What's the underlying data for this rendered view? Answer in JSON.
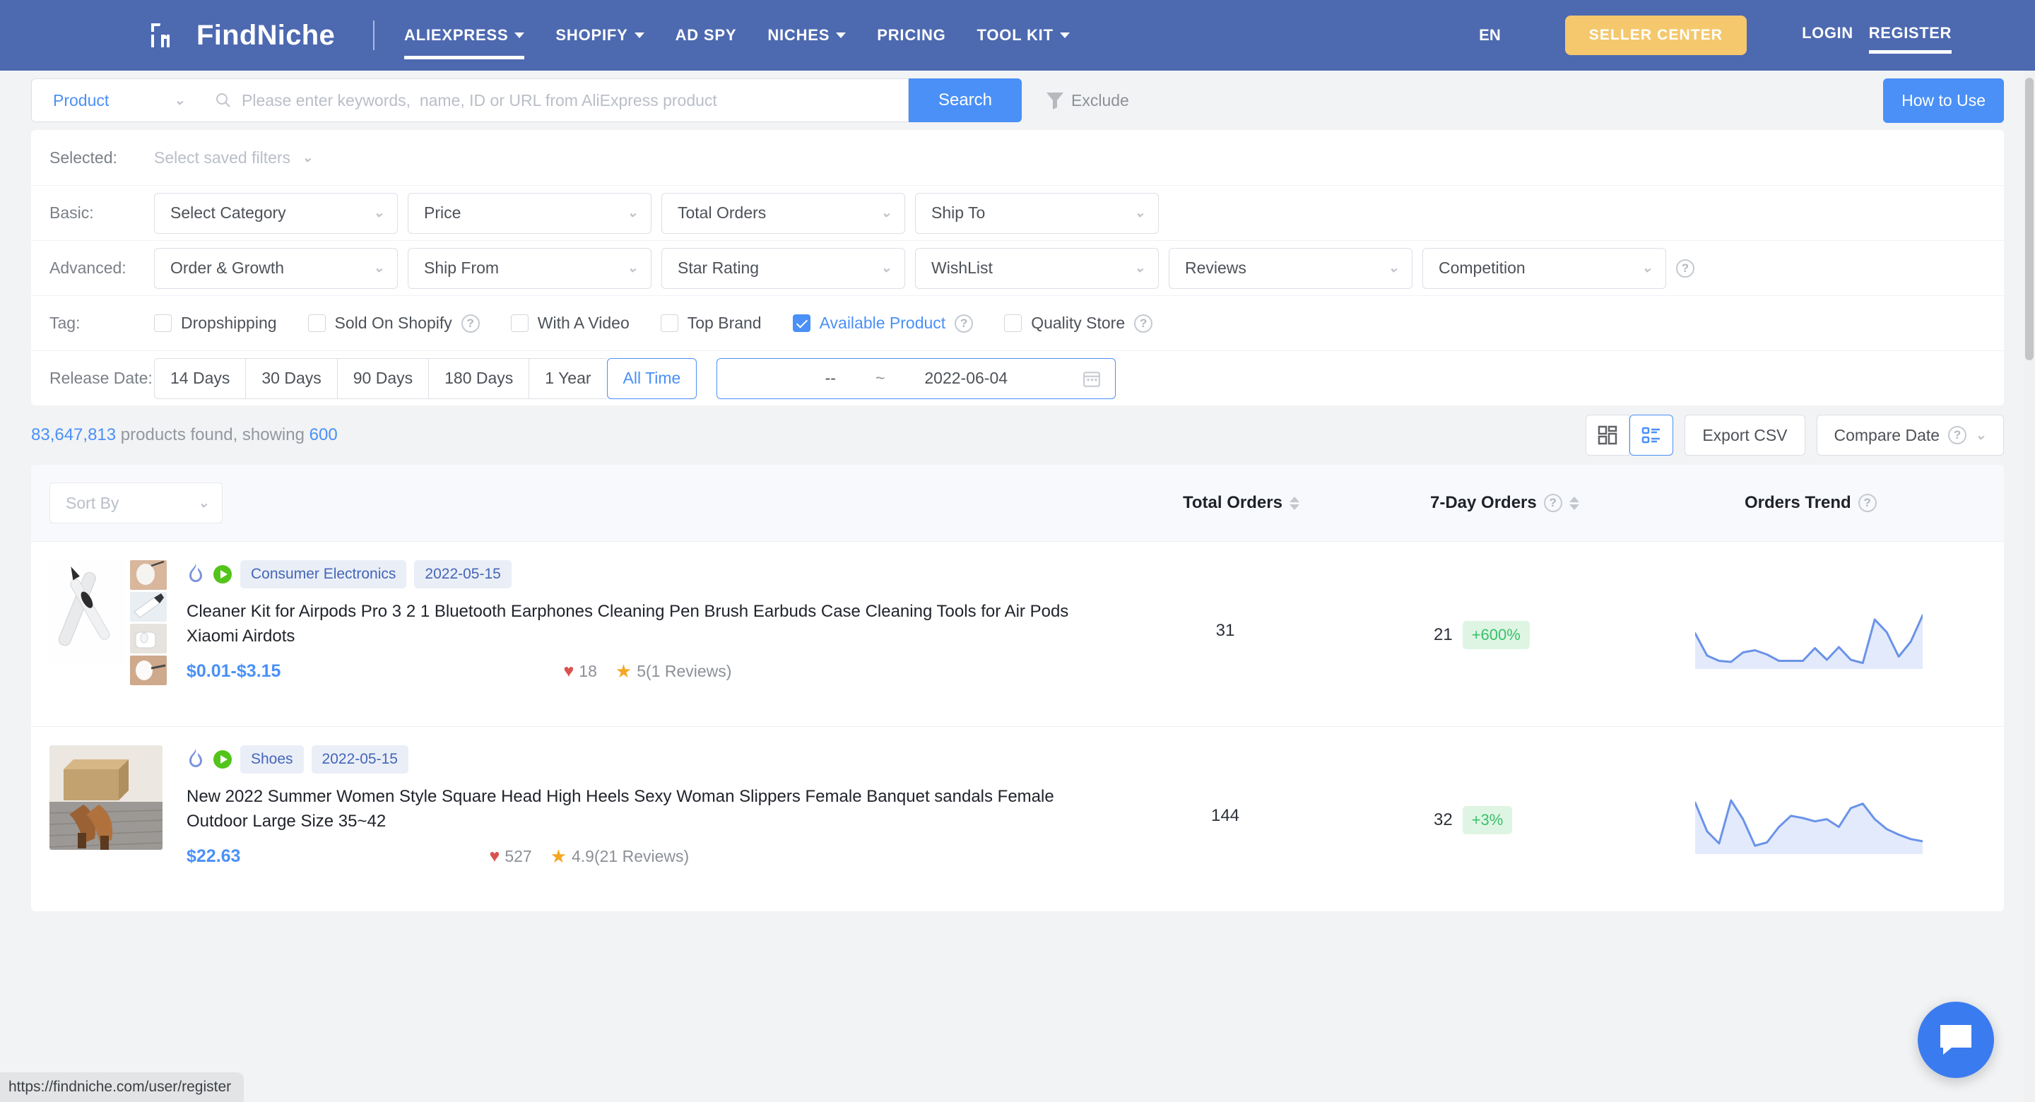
{
  "header": {
    "brand": "FindNiche",
    "nav": [
      {
        "label": "ALIEXPRESS",
        "caret": true,
        "active": true
      },
      {
        "label": "SHOPIFY",
        "caret": true,
        "active": false
      },
      {
        "label": "AD SPY",
        "caret": false,
        "active": false
      },
      {
        "label": "NICHES",
        "caret": true,
        "active": false
      },
      {
        "label": "PRICING",
        "caret": false,
        "active": false
      },
      {
        "label": "TOOL KIT",
        "caret": true,
        "active": false
      }
    ],
    "language": "EN",
    "seller_center": "SELLER CENTER",
    "login": "LOGIN",
    "register": "REGISTER",
    "brand_bg": "#4d69b0",
    "seller_bg": "#f5c86e"
  },
  "search": {
    "type_selected": "Product",
    "placeholder": "Please enter keywords,  name, ID or URL from AliExpress product",
    "value": "",
    "search_button": "Search",
    "exclude_label": "Exclude",
    "how_to_use": "How to Use"
  },
  "filters": {
    "selected_label": "Selected:",
    "saved_filters_placeholder": "Select saved filters",
    "basic_label": "Basic:",
    "basic": [
      "Select Category",
      "Price",
      "Total Orders",
      "Ship To"
    ],
    "advanced_label": "Advanced:",
    "advanced": [
      "Order & Growth",
      "Ship From",
      "Star Rating",
      "WishList",
      "Reviews",
      "Competition"
    ],
    "tag_label": "Tag:",
    "tags": [
      {
        "label": "Dropshipping",
        "checked": false,
        "help": false
      },
      {
        "label": "Sold On Shopify",
        "checked": false,
        "help": true
      },
      {
        "label": "With A Video",
        "checked": false,
        "help": false
      },
      {
        "label": "Top Brand",
        "checked": false,
        "help": false
      },
      {
        "label": "Available Product",
        "checked": true,
        "help": true
      },
      {
        "label": "Quality Store",
        "checked": false,
        "help": true
      }
    ],
    "release_label": "Release Date:",
    "release_segments": [
      {
        "label": "14 Days",
        "active": false
      },
      {
        "label": "30 Days",
        "active": false
      },
      {
        "label": "90 Days",
        "active": false
      },
      {
        "label": "180 Days",
        "active": false
      },
      {
        "label": "1 Year",
        "active": false
      },
      {
        "label": "All Time",
        "active": true
      }
    ],
    "date_from": "--",
    "date_sep": "~",
    "date_to": "2022-06-04"
  },
  "results": {
    "count": "83,647,813",
    "count_text": " products found, showing ",
    "showing": "600",
    "export_csv": "Export CSV",
    "compare_date": "Compare Date",
    "sort_by_placeholder": "Sort By",
    "columns": {
      "total_orders": "Total Orders",
      "seven_day_orders": "7-Day Orders",
      "orders_trend": "Orders Trend"
    },
    "rows": [
      {
        "category": "Consumer Electronics",
        "date": "2022-05-15",
        "title": "Cleaner Kit for Airpods Pro 3 2 1 Bluetooth Earphones Cleaning Pen Brush Earbuds Case Cleaning Tools for Air Pods Xiaomi Airdots",
        "price": "$0.01-$3.15",
        "wishlist": "18",
        "rating": "5(1 Reviews)",
        "total_orders": "31",
        "seven_day_orders": "21",
        "growth": "+600%",
        "trend": [
          62,
          20,
          10,
          8,
          26,
          30,
          22,
          10,
          10,
          10,
          34,
          12,
          36,
          12,
          6,
          88,
          64,
          18,
          46,
          96
        ]
      },
      {
        "category": "Shoes",
        "date": "2022-05-15",
        "title": "New 2022 Summer Women Style Square Head High Heels Sexy Woman Slippers Female Banquet sandals Female Outdoor Large Size 35~42",
        "price": "$22.63",
        "wishlist": "527",
        "rating": "4.9(21 Reviews)",
        "total_orders": "144",
        "seven_day_orders": "32",
        "growth": "+3%",
        "trend": [
          88,
          36,
          14,
          92,
          58,
          10,
          16,
          44,
          64,
          60,
          54,
          58,
          44,
          78,
          86,
          58,
          40,
          30,
          22,
          18
        ]
      }
    ]
  },
  "overlay": {
    "status_url": "https://findniche.com/user/register"
  }
}
